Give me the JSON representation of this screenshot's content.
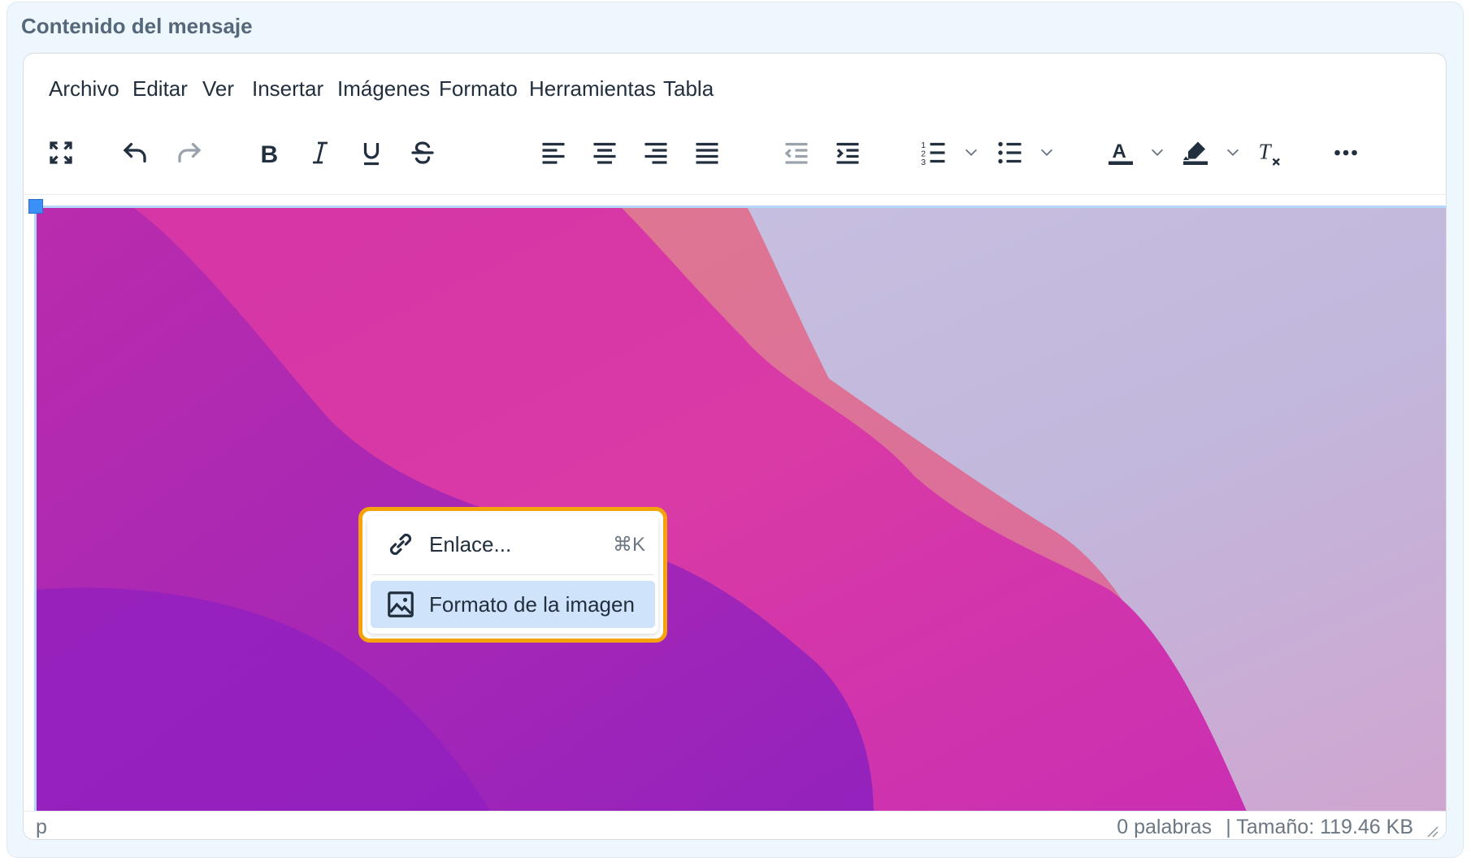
{
  "panel": {
    "title": "Contenido del mensaje"
  },
  "menubar": {
    "items": [
      {
        "label": "Archivo"
      },
      {
        "label": "Editar"
      },
      {
        "label": "Ver"
      },
      {
        "label": "Insertar"
      },
      {
        "label": "Imágenes"
      },
      {
        "label": "Formato"
      },
      {
        "label": "Herramientas"
      },
      {
        "label": "Tabla"
      }
    ]
  },
  "toolbar": {
    "buttons": [
      "fullscreen-icon",
      "undo-icon",
      "redo-icon",
      "bold-icon",
      "italic-icon",
      "underline-icon",
      "strikethrough-icon",
      "align-left-icon",
      "align-center-icon",
      "align-right-icon",
      "align-justify-icon",
      "outdent-icon",
      "indent-icon",
      "numbered-list-icon",
      "bullet-list-icon",
      "text-color-icon",
      "highlight-icon",
      "clear-formatting-icon",
      "more-icon"
    ],
    "colors": {
      "icon": "#222f3e",
      "disabled": "#9aa3ac"
    }
  },
  "context_menu": {
    "items": [
      {
        "label": "Enlace...",
        "shortcut": "⌘K",
        "icon": "link-icon",
        "selected": false
      },
      {
        "label": "Formato de la imagen",
        "icon": "image-icon",
        "selected": true
      }
    ],
    "highlight_color": "#f5a30a"
  },
  "statusbar": {
    "path": "p",
    "word_count": "0 palabras",
    "size": "| Tamaño: 119.46 KB"
  }
}
